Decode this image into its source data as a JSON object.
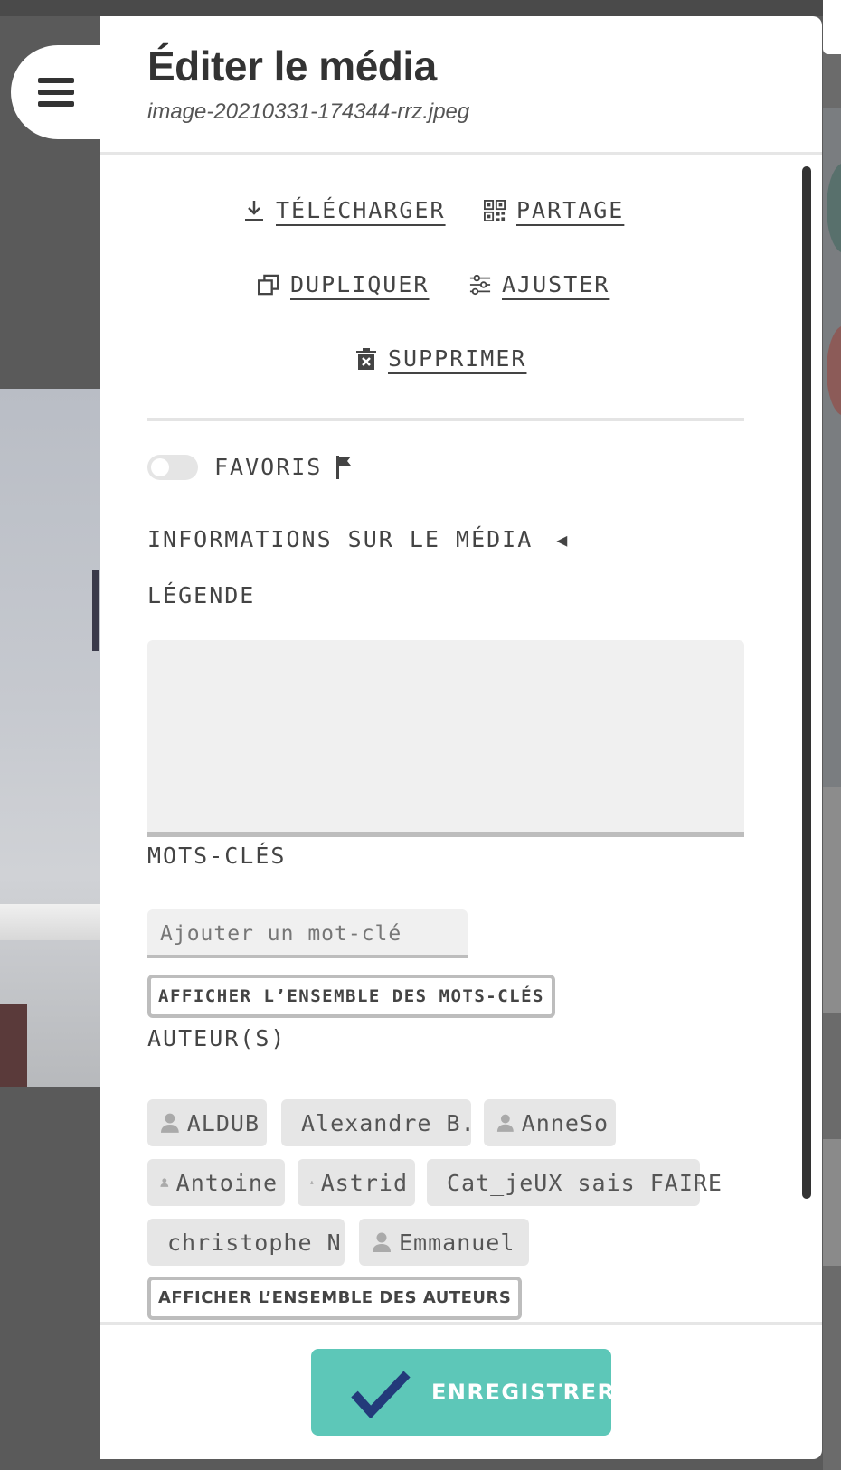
{
  "header": {
    "title": "Éditer le média",
    "filename": "image-20210331-174344-rrz.jpeg"
  },
  "actions": {
    "download": "TÉLÉCHARGER",
    "share": "PARTAGE",
    "duplicate": "DUPLIQUER",
    "adjust": "AJUSTER",
    "delete": "SUPPRIMER"
  },
  "favorites": {
    "label": "FAVORIS",
    "enabled": false
  },
  "media_info": {
    "label": "INFORMATIONS SUR LE MÉDIA",
    "toggle_glyph": "◀"
  },
  "caption": {
    "label": "LÉGENDE",
    "value": ""
  },
  "keywords": {
    "label": "MOTS-CLÉS",
    "placeholder": "Ajouter un mot-clé",
    "show_all": "AFFICHER L’ENSEMBLE DES MOTS-CLÉS"
  },
  "authors": {
    "label": "AUTEUR(S)",
    "items": [
      "ALDUB",
      "Alexandre B.",
      "AnneSo",
      "Antoine",
      "Astrid",
      "Cat_jeUX sais FAIRE",
      "christophe N",
      "Emmanuel"
    ],
    "show_all": "AFFICHER L’ENSEMBLE DES AUTEURS"
  },
  "footer": {
    "save": "ENREGISTRER"
  },
  "colors": {
    "accent": "#5dc7b8",
    "check": "#233a7a",
    "text": "#444444"
  }
}
